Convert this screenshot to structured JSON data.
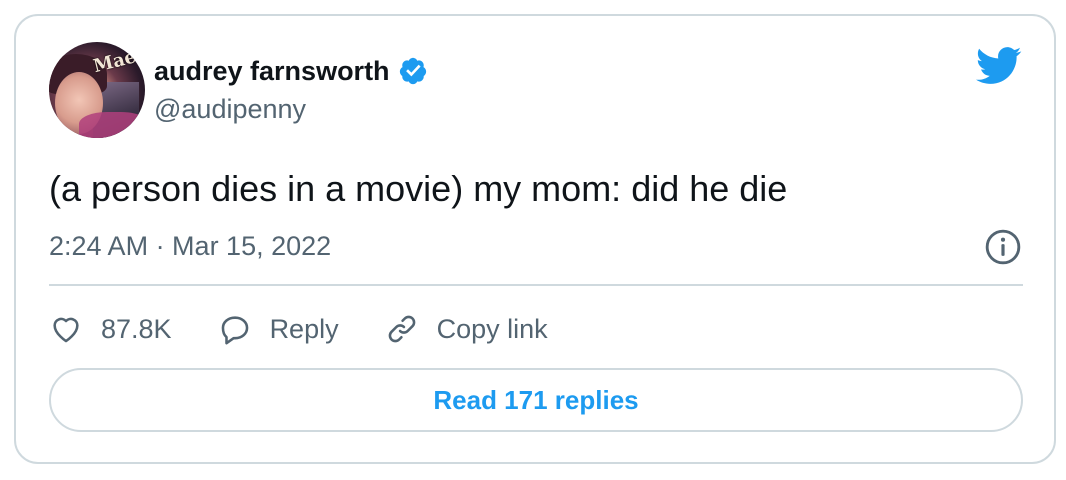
{
  "author": {
    "name": "audrey farnsworth",
    "handle": "@audipenny",
    "avatar_sign": "Maes"
  },
  "tweet": {
    "text": "(a person dies in a movie) my mom: did he die",
    "timestamp": "2:24 AM · Mar 15, 2022"
  },
  "actions": {
    "likes": "87.8K",
    "reply_label": "Reply",
    "copy_link_label": "Copy link"
  },
  "read_replies_label": "Read 171 replies",
  "icons": {
    "verified": "verified-badge-icon",
    "brand": "twitter-bird-icon",
    "info": "info-icon",
    "like": "heart-icon",
    "reply": "speech-bubble-icon",
    "copy_link": "link-icon"
  },
  "colors": {
    "accent": "#1d9bf0",
    "text": "#0f1419",
    "secondary": "#536471",
    "border": "#cfd9de"
  }
}
